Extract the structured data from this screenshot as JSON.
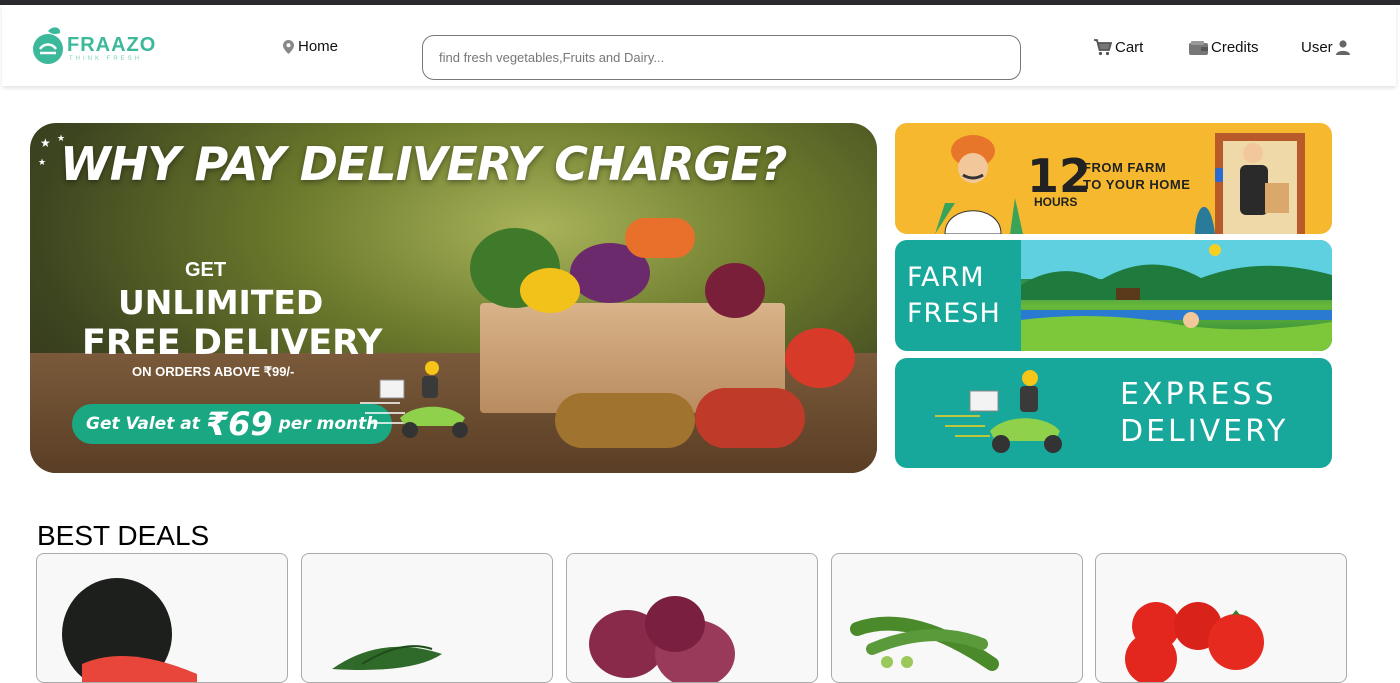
{
  "header": {
    "logo_text": "FRAAZO",
    "logo_tagline": "THINK FRESH",
    "home_label": "Home",
    "search_placeholder": "find fresh vegetables,Fruits and Dairy...",
    "cart_label": "Cart",
    "credits_label": "Credits",
    "user_label": "User"
  },
  "hero": {
    "title": "WHY PAY DELIVERY CHARGE?",
    "get": "GET",
    "unlimited": "UNLIMITED",
    "free_delivery": "FREE DELIVERY",
    "orders_above": "ON ORDERS ABOVE ₹99/-",
    "valet_prefix": "Get Valet at",
    "valet_price": "₹69",
    "valet_suffix": "per month"
  },
  "side_banners": {
    "b1_number": "12",
    "b1_line1": "FROM FARM",
    "b1_line2": "TO YOUR HOME",
    "b1_hours": "HOURS",
    "b2_line1": "FARM",
    "b2_line2": "FRESH",
    "b3_line1": "EXPRESS",
    "b3_line2": "DELIVERY"
  },
  "best_deals": {
    "title": "BEST DEALS",
    "items": [
      {
        "icon": "watermelon-image"
      },
      {
        "icon": "spinach-image"
      },
      {
        "icon": "onion-image"
      },
      {
        "icon": "okra-image"
      },
      {
        "icon": "tomato-image"
      }
    ]
  },
  "colors": {
    "brand": "#3cb89a",
    "banner_yellow": "#f5b82e",
    "banner_teal": "#17a79b",
    "valet_green": "#1aa883"
  }
}
